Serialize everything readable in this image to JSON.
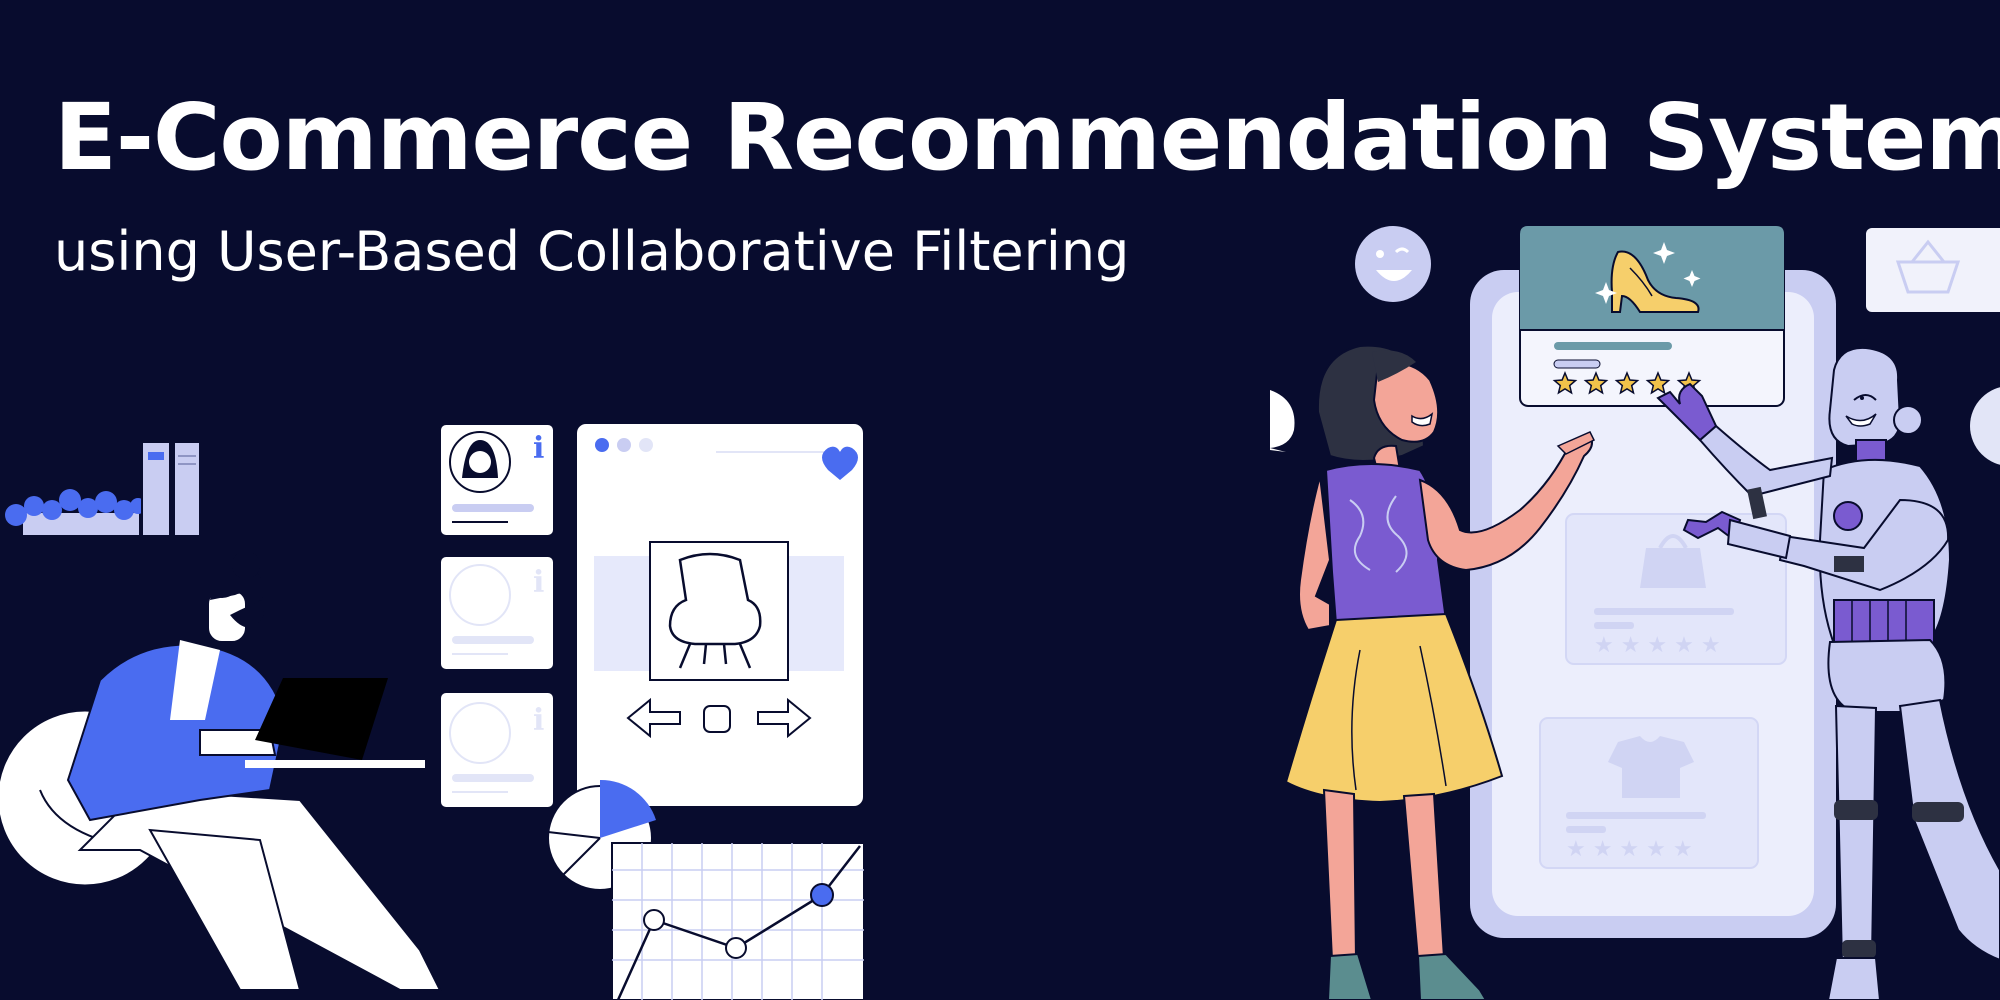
{
  "header": {
    "title": "E-Commerce Recommendation System",
    "subtitle": "using User-Based Collaborative Filtering"
  },
  "colors": {
    "background": "#080c2e",
    "accent_blue": "#4a6cf0",
    "lavender": "#c9cdf2",
    "teal": "#6b9aa8",
    "yellow": "#f6cf6b",
    "purple": "#7a5bd0",
    "star": "#f1c24a"
  },
  "illustration": {
    "featured_product_rating": 5,
    "other_product_ratings": [
      5,
      5
    ],
    "icons": [
      "smiley-icon",
      "shopping-basket-icon",
      "heart-icon",
      "info-icon",
      "high-heel-icon",
      "armchair-icon",
      "bag-icon",
      "tshirt-icon",
      "pie-chart-icon",
      "line-chart-icon"
    ]
  }
}
